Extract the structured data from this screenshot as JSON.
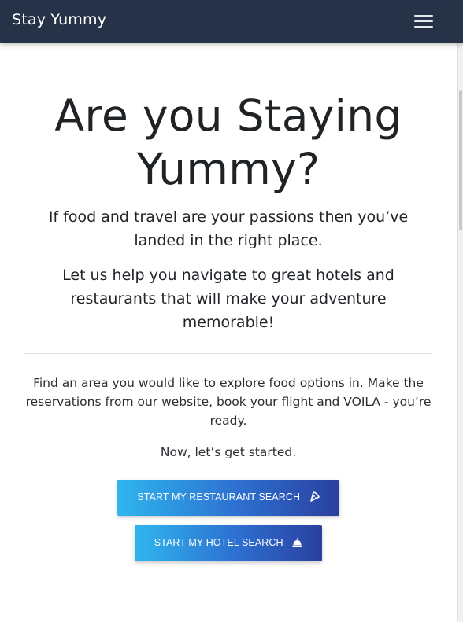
{
  "navbar": {
    "brand": "Stay Yummy",
    "menu_icon": "hamburger-menu-icon"
  },
  "hero": {
    "title": "Are you Staying Yummy?",
    "lead": "If food and travel are your passions then you’ve landed in the right place.",
    "lead2": "Let us help you navigate to great hotels and restaurants that will make your adventure memorable!"
  },
  "content": {
    "description": "Find an area you would like to explore food options in. Make the reservations from our website, book your flight and VOILA - you’re ready.",
    "cta_text": "Now, let’s get started."
  },
  "buttons": {
    "restaurant_label": "START MY RESTAURANT SEARCH",
    "restaurant_icon": "pizza-slice-icon",
    "hotel_label": "START MY HOTEL SEARCH",
    "hotel_icon": "concierge-bell-icon"
  },
  "colors": {
    "navbar_bg": "#263247",
    "button_gradient_start": "#2fb6ee",
    "button_gradient_end": "#2a3f9e"
  }
}
